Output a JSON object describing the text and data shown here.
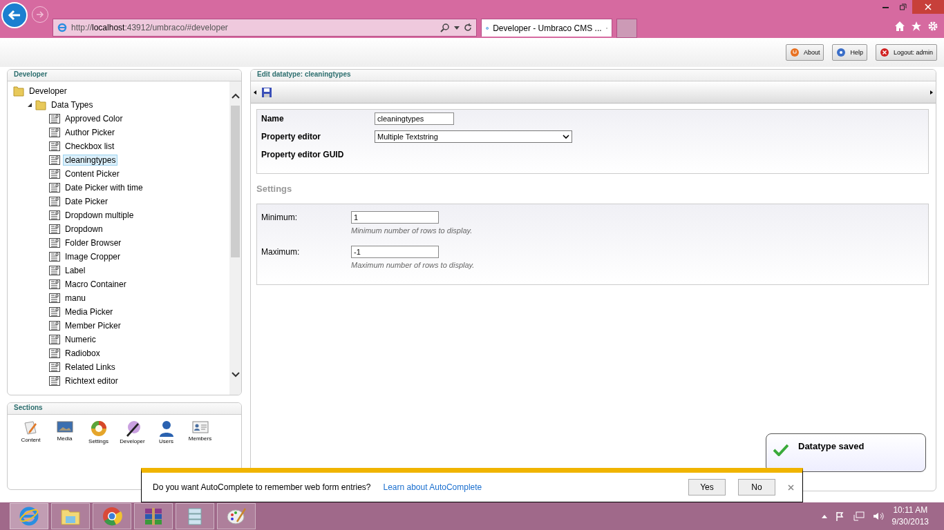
{
  "browser": {
    "address": "http://**localhost**:43912/umbraco/#developer",
    "tabs": [
      {
        "title": "Developer - Umbraco CMS ...",
        "selected": true
      }
    ]
  },
  "header_buttons": [
    "About",
    "Help",
    "Logout: admin"
  ],
  "tree_panel": {
    "title": "Developer",
    "tree": [
      {
        "label": "Developer",
        "kind": "folder",
        "selected": false,
        "children": [
          {
            "label": "Data Types",
            "kind": "folder",
            "expanded": true,
            "selected": false,
            "children": [
              {
                "label": "Approved Color",
                "kind": "datatype",
                "selected": false
              },
              {
                "label": "Author Picker",
                "kind": "datatype",
                "selected": false
              },
              {
                "label": "Checkbox list",
                "kind": "datatype",
                "selected": false
              },
              {
                "label": "cleaningtypes",
                "kind": "datatype",
                "selected": true
              },
              {
                "label": "Content Picker",
                "kind": "datatype",
                "selected": false
              },
              {
                "label": "Date Picker with time",
                "kind": "datatype",
                "selected": false
              },
              {
                "label": "Date Picker",
                "kind": "datatype",
                "selected": false
              },
              {
                "label": "Dropdown multiple",
                "kind": "datatype",
                "selected": false
              },
              {
                "label": "Dropdown",
                "kind": "datatype",
                "selected": false
              },
              {
                "label": "Folder Browser",
                "kind": "datatype",
                "selected": false
              },
              {
                "label": "Image Cropper",
                "kind": "datatype",
                "selected": false
              },
              {
                "label": "Label",
                "kind": "datatype",
                "selected": false
              },
              {
                "label": "Macro Container",
                "kind": "datatype",
                "selected": false
              },
              {
                "label": "manu",
                "kind": "datatype",
                "selected": false
              },
              {
                "label": "Media Picker",
                "kind": "datatype",
                "selected": false
              },
              {
                "label": "Member Picker",
                "kind": "datatype",
                "selected": false
              },
              {
                "label": "Numeric",
                "kind": "datatype",
                "selected": false
              },
              {
                "label": "Radiobox",
                "kind": "datatype",
                "selected": false
              },
              {
                "label": "Related Links",
                "kind": "datatype",
                "selected": false
              },
              {
                "label": "Richtext editor",
                "kind": "datatype",
                "selected": false
              }
            ]
          }
        ]
      }
    ]
  },
  "sections_panel": {
    "title": "Sections",
    "items": [
      "Content",
      "Media",
      "Settings",
      "Developer",
      "Users",
      "Members"
    ]
  },
  "editor": {
    "title": "Edit datatype: cleaningtypes",
    "fields": [
      {
        "label": "Name",
        "kind": "text",
        "value": "cleaningtypes"
      },
      {
        "label": "Property editor",
        "kind": "select",
        "value": "Multiple Textstring"
      },
      {
        "label": "Property editor GUID",
        "kind": "static"
      }
    ],
    "settings_title": "Settings",
    "settings": [
      {
        "label": "Minimum:",
        "value": "1",
        "hint": "Minimum number of rows to display."
      },
      {
        "label": "Maximum:",
        "value": "-1",
        "hint": "Maximum number of rows to display."
      }
    ]
  },
  "toast": {
    "message": "Datatype saved"
  },
  "autocomplete_bar": {
    "question": "Do you want AutoComplete to remember web form entries?",
    "link": "Learn about AutoComplete",
    "buttons": [
      "Yes",
      "No"
    ]
  },
  "taskbar": {
    "time": "10:11 AM",
    "date": "9/30/2013"
  }
}
